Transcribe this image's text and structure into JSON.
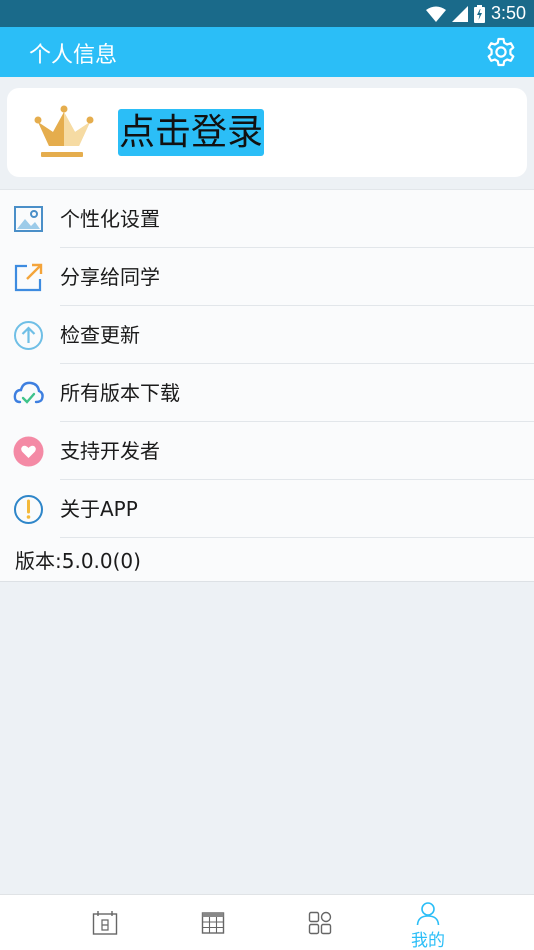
{
  "status_bar": {
    "time": "3:50",
    "icons": [
      "wifi-icon",
      "signal-icon",
      "battery-charging-icon"
    ]
  },
  "app_bar": {
    "title": "个人信息",
    "settings_icon": "gear-icon"
  },
  "login": {
    "label": "点击登录",
    "icon": "crown-icon"
  },
  "menu": {
    "items": [
      {
        "label": "个性化设置",
        "icon": "image-icon"
      },
      {
        "label": "分享给同学",
        "icon": "share-icon"
      },
      {
        "label": "检查更新",
        "icon": "upload-arrow-icon"
      },
      {
        "label": "所有版本下载",
        "icon": "cloud-check-icon"
      },
      {
        "label": "支持开发者",
        "icon": "heart-icon"
      },
      {
        "label": "关于APP",
        "icon": "info-exclamation-icon"
      }
    ],
    "version": "版本:5.0.0(0)"
  },
  "bottom_nav": {
    "items": [
      {
        "icon": "calendar-day-icon",
        "label": ""
      },
      {
        "icon": "table-icon",
        "label": ""
      },
      {
        "icon": "grid-apps-icon",
        "label": ""
      },
      {
        "icon": "person-icon",
        "label": "我的",
        "active": true
      }
    ]
  },
  "colors": {
    "accent": "#2bbef7",
    "status_bar": "#1a6a8a",
    "background": "#edf1f5",
    "crown_gold": "#e5ad4d",
    "heart_pink": "#f48aa5"
  }
}
